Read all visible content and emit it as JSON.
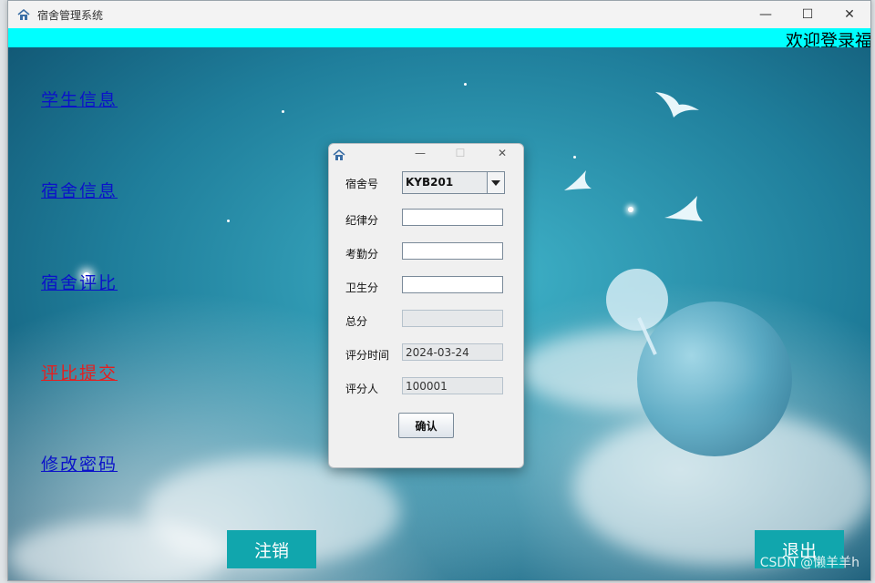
{
  "window": {
    "title": "宿舍管理系统",
    "controls": {
      "minimize": "—",
      "maximize": "☐",
      "close": "✕"
    }
  },
  "marquee": {
    "text": "欢迎登录福"
  },
  "nav": [
    {
      "label": "学生信息"
    },
    {
      "label": "宿舍信息"
    },
    {
      "label": "宿舍评比"
    },
    {
      "label": "评比提交"
    },
    {
      "label": "修改密码"
    }
  ],
  "buttons": {
    "logout": "注销",
    "exit": "退出"
  },
  "dialog": {
    "controls": {
      "minimize": "—",
      "maximize": "☐",
      "close": "✕"
    },
    "dorm_label": "宿舍号",
    "dorm_value": "KYB201",
    "discipline_label": "纪律分",
    "discipline_value": "",
    "attendance_label": "考勤分",
    "attendance_value": "",
    "hygiene_label": "卫生分",
    "hygiene_value": "",
    "total_label": "总分",
    "total_value": "",
    "time_label": "评分时间",
    "time_value": "2024-03-24",
    "rater_label": "评分人",
    "rater_value": "100001",
    "confirm_label": "确认"
  },
  "watermark": "CSDN @懒羊羊h",
  "colors": {
    "marquee": "#00ffff",
    "link": "#0b12c9",
    "link_active": "#e51f1f",
    "button_bg": "#11a6ad"
  }
}
